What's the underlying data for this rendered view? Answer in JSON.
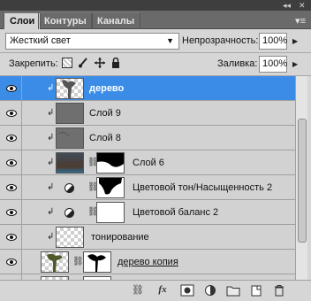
{
  "tabs": [
    "Слои",
    "Контуры",
    "Каналы"
  ],
  "blend": {
    "mode": "Жесткий свет",
    "opacity_label": "Непрозрачность:",
    "opacity": "100%"
  },
  "lock": {
    "label": "Закрепить:",
    "fill_label": "Заливка:",
    "fill": "100%"
  },
  "layers": [
    {
      "name": "дерево",
      "selected": true
    },
    {
      "name": "Слой 9"
    },
    {
      "name": "Слой 8"
    },
    {
      "name": "Слой 6"
    },
    {
      "name": "Цветовой тон/Насыщенность 2"
    },
    {
      "name": "Цветовой баланс 2"
    },
    {
      "name": "тонирование"
    },
    {
      "name": "дерево копия"
    }
  ],
  "colors": {
    "selection": "#3b8ce6",
    "panel": "#d6d6d6",
    "titlebar": "#3e3e3e"
  }
}
